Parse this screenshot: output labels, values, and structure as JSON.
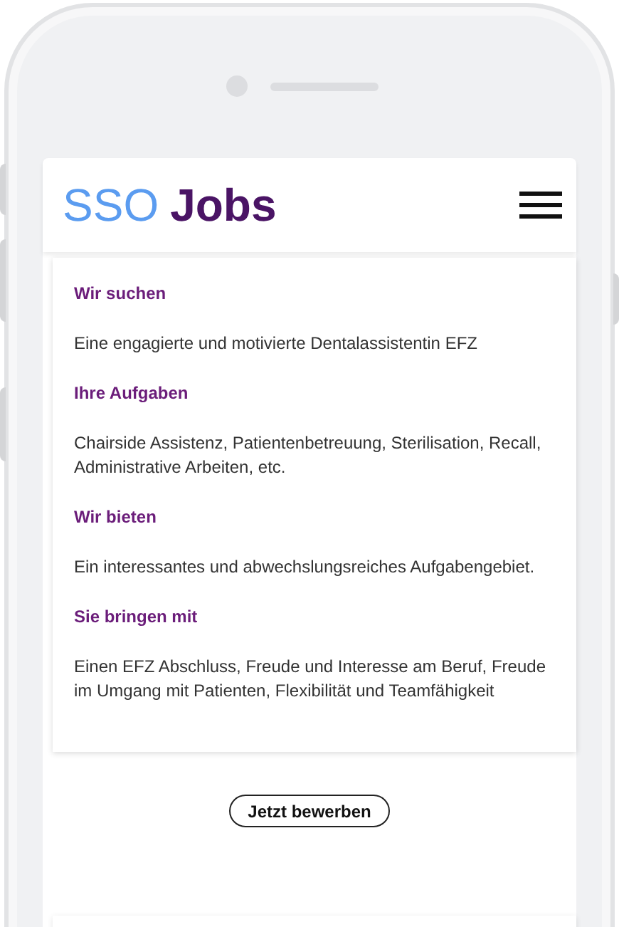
{
  "header": {
    "logo": {
      "prefix": "SSO",
      "name": "Jobs"
    }
  },
  "sections": [
    {
      "heading": "Wir suchen",
      "text": "Eine engagierte und motivierte Dentalassistentin EFZ"
    },
    {
      "heading": "Ihre Aufgaben",
      "text": "Chairside Assistenz, Patientenbetreuung, Sterilisation, Recall, Administrative Arbeiten, etc."
    },
    {
      "heading": "Wir bieten",
      "text": "Ein interessantes und abwechslungsreiches Aufgabengebiet."
    },
    {
      "heading": "Sie bringen mit",
      "text": "Einen EFZ Abschluss, Freude und Interesse am Beruf, Freude im Umgang mit Patienten, Flexibilität und Teamfähigkeit"
    }
  ],
  "apply_button": "Jetzt bewerben"
}
